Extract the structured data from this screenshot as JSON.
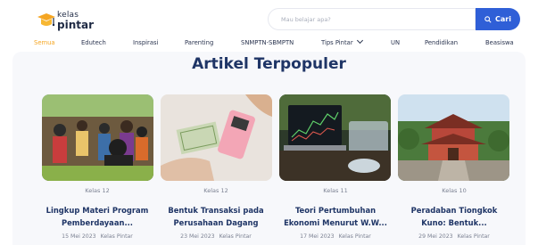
{
  "header": {
    "logo": {
      "line1": "kelas",
      "line2": "pintar"
    },
    "search": {
      "placeholder": "Mau belajar apa?",
      "button_label": "Cari"
    }
  },
  "nav": {
    "items": [
      {
        "label": "Semua",
        "active": true
      },
      {
        "label": "Edutech",
        "active": false
      },
      {
        "label": "Inspirasi",
        "active": false
      },
      {
        "label": "Parenting",
        "active": false
      },
      {
        "label": "SNMPTN-SBMPTN",
        "active": false
      },
      {
        "label": "Tips Pintar",
        "active": false,
        "has_dropdown": true
      },
      {
        "label": "UN",
        "active": false
      },
      {
        "label": "Pendidikan",
        "active": false
      },
      {
        "label": "Beasiswa",
        "active": false
      }
    ]
  },
  "main": {
    "section_title": "Artikel Terpopuler",
    "cards": [
      {
        "grade": "Kelas 12",
        "title_line1": "Lingkup Materi Program",
        "title_line2": "Pemberdayaan...",
        "date": "15 Mei 2023",
        "author": "Kelas Pintar",
        "image": "community-crowd-photo"
      },
      {
        "grade": "Kelas 12",
        "title_line1": "Bentuk Transaksi pada",
        "title_line2": "Perusahaan Dagang",
        "date": "23 Mei 2023",
        "author": "Kelas Pintar",
        "image": "card-payment-photo"
      },
      {
        "grade": "Kelas 11",
        "title_line1": "Teori Pertumbuhan",
        "title_line2": "Ekonomi Menurut W.W...",
        "date": "17 Mei 2023",
        "author": "Kelas Pintar",
        "image": "stock-chart-laptop-photo"
      },
      {
        "grade": "Kelas 10",
        "title_line1": "Peradaban Tiongkok",
        "title_line2": "Kuno: Bentuk...",
        "date": "29 Mei 2023",
        "author": "Kelas Pintar",
        "image": "chinese-temple-photo"
      }
    ]
  },
  "colors": {
    "brand_yellow": "#f5a623",
    "primary_blue": "#2f5fd7",
    "title_navy": "#1f3566"
  }
}
